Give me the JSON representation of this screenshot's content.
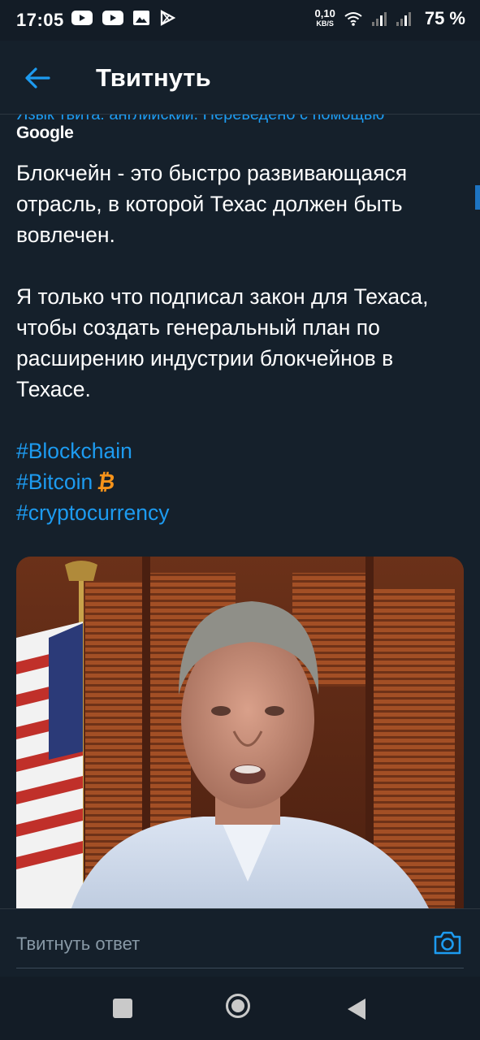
{
  "status_bar": {
    "time": "17:05",
    "net_speed": "0,10",
    "net_unit": "KB/S",
    "battery": "75 %"
  },
  "header": {
    "title": "Твитнуть"
  },
  "tweet": {
    "translated_note": "Язык твита: английский. Переведено с помощью",
    "translator": "Google",
    "paragraph_1": "Блокчейн - это быстро развивающаяся отрасль, в которой Техас должен быть вовлечен.",
    "paragraph_2": " Я только что подписал закон для Техаса, чтобы создать генеральный план по расширению индустрии блокчейнов в Техасе.",
    "hashtags": [
      "#Blockchain",
      "#Bitcoin",
      "#cryptocurrency"
    ],
    "bitcoin_emoji": "₿"
  },
  "reply": {
    "placeholder": "Твитнуть ответ"
  },
  "colors": {
    "background": "#15202b",
    "accent": "#1d9bf0",
    "bitcoin": "#f7931a"
  },
  "icons": [
    "back-arrow-icon",
    "camera-icon",
    "youtube-icon",
    "image-icon",
    "play-store-icon",
    "wifi-icon",
    "signal-icon"
  ]
}
